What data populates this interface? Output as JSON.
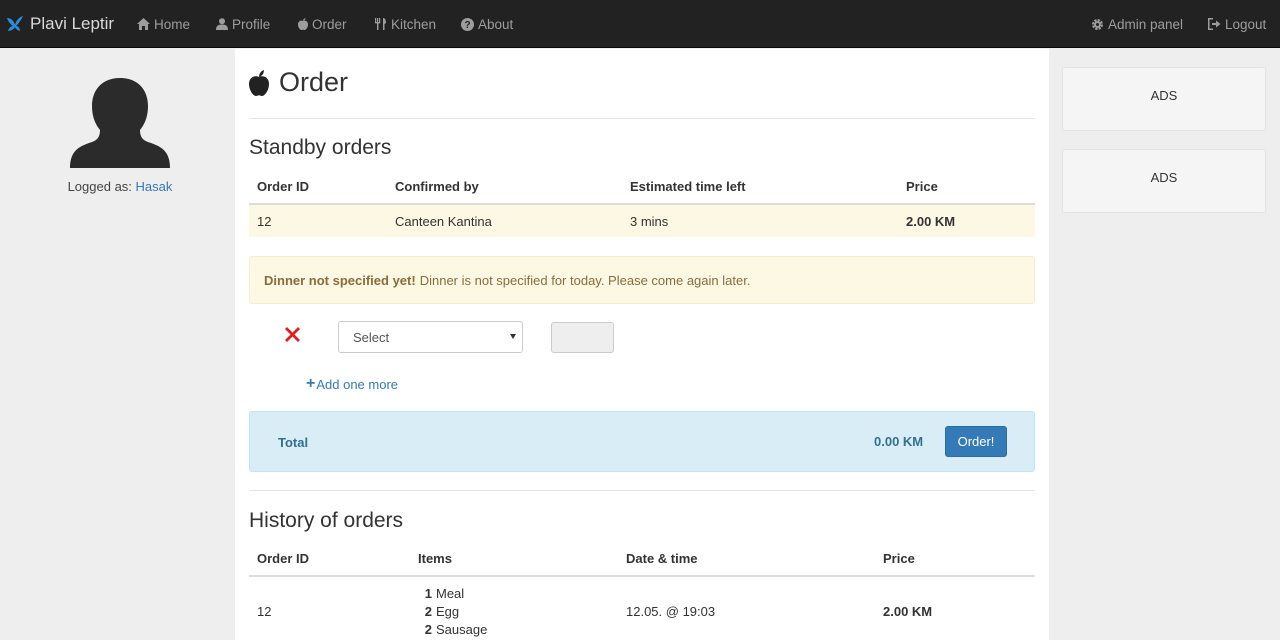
{
  "nav": {
    "brand": "Plavi Leptir",
    "items": [
      {
        "label": "Home",
        "icon": "home-icon"
      },
      {
        "label": "Profile",
        "icon": "user-icon"
      },
      {
        "label": "Order",
        "icon": "apple-icon"
      },
      {
        "label": "Kitchen",
        "icon": "cutlery-icon"
      },
      {
        "label": "About",
        "icon": "question-circle-icon"
      }
    ],
    "right": [
      {
        "label": "Admin panel",
        "icon": "gear-icon"
      },
      {
        "label": "Logout",
        "icon": "logout-icon"
      }
    ]
  },
  "sidebar": {
    "logged_prefix": "Logged as:",
    "username": "Hasak"
  },
  "main": {
    "title": "Order",
    "standby": {
      "title": "Standby orders",
      "columns": [
        "Order ID",
        "Confirmed by",
        "Estimated time left",
        "Price"
      ],
      "rows": [
        {
          "id": "12",
          "confirmed_by": "Canteen Kantina",
          "time_left": "3 mins",
          "price": "2.00 KM"
        }
      ]
    },
    "alert": {
      "strong": "Dinner not specified yet!",
      "text": "Dinner is not specified for today. Please come again later."
    },
    "order_form": {
      "select_value": "Select",
      "quantity": "",
      "add_more": "Add one more"
    },
    "total": {
      "label": "Total",
      "value": "0.00 KM",
      "button": "Order!"
    },
    "history": {
      "title": "History of orders",
      "columns": [
        "Order ID",
        "Items",
        "Date & time",
        "Price"
      ],
      "rows": [
        {
          "id": "12",
          "items": [
            {
              "qty": "1",
              "name": "Meal"
            },
            {
              "qty": "2",
              "name": "Egg"
            },
            {
              "qty": "2",
              "name": "Sausage"
            }
          ],
          "datetime": "12.05. @ 19:03",
          "price": "2.00 KM"
        }
      ]
    }
  },
  "ads": [
    "ADS",
    "ADS"
  ],
  "colors": {
    "navbar": "#222222",
    "link": "#337ab7",
    "warning_bg": "#fcf8e3",
    "info_bg": "#d9edf7",
    "danger": "#e02020"
  }
}
